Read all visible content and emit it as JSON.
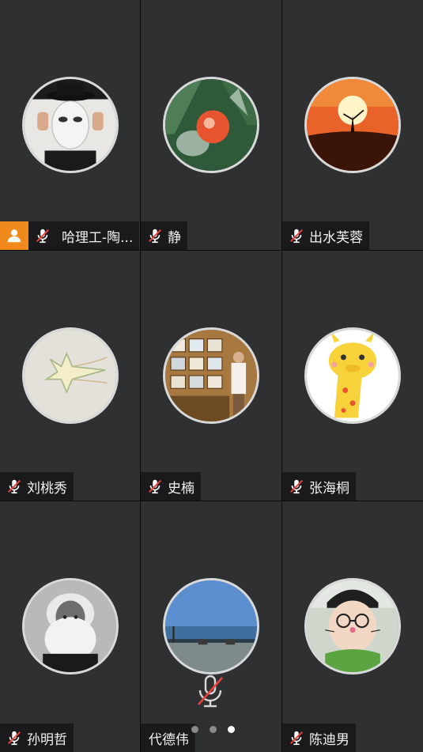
{
  "participants": [
    {
      "name": "哈理工-陶...",
      "is_host": true,
      "muted": true,
      "avatar": "man-with-white-mask"
    },
    {
      "name": "静",
      "is_host": false,
      "muted": true,
      "avatar": "orange-flower-in-glass"
    },
    {
      "name": "出水芙蓉",
      "is_host": false,
      "muted": true,
      "avatar": "dancer-silhouette-sunset"
    },
    {
      "name": "刘桃秀",
      "is_host": false,
      "muted": true,
      "avatar": "shooting-star-drawing"
    },
    {
      "name": "史楠",
      "is_host": false,
      "muted": true,
      "avatar": "man-in-gallery"
    },
    {
      "name": "张海桐",
      "is_host": false,
      "muted": true,
      "avatar": "cartoon-giraffe"
    },
    {
      "name": "孙明哲",
      "is_host": false,
      "muted": true,
      "avatar": "bearded-man-portrait"
    },
    {
      "name": "代德伟",
      "is_host": false,
      "muted": true,
      "avatar": "seaside-pier"
    },
    {
      "name": "陈迪男",
      "is_host": false,
      "muted": true,
      "avatar": "boy-with-cat-filter"
    }
  ],
  "pagination": {
    "pages": 3,
    "current": 3
  },
  "colors": {
    "host_badge": "#f08a1d",
    "mute_slash": "#e8413c",
    "tile_bg": "#2e3032"
  },
  "icons": {
    "host": "person-icon",
    "mic": "mic-muted-icon",
    "center_mic": "mic-muted-icon"
  }
}
